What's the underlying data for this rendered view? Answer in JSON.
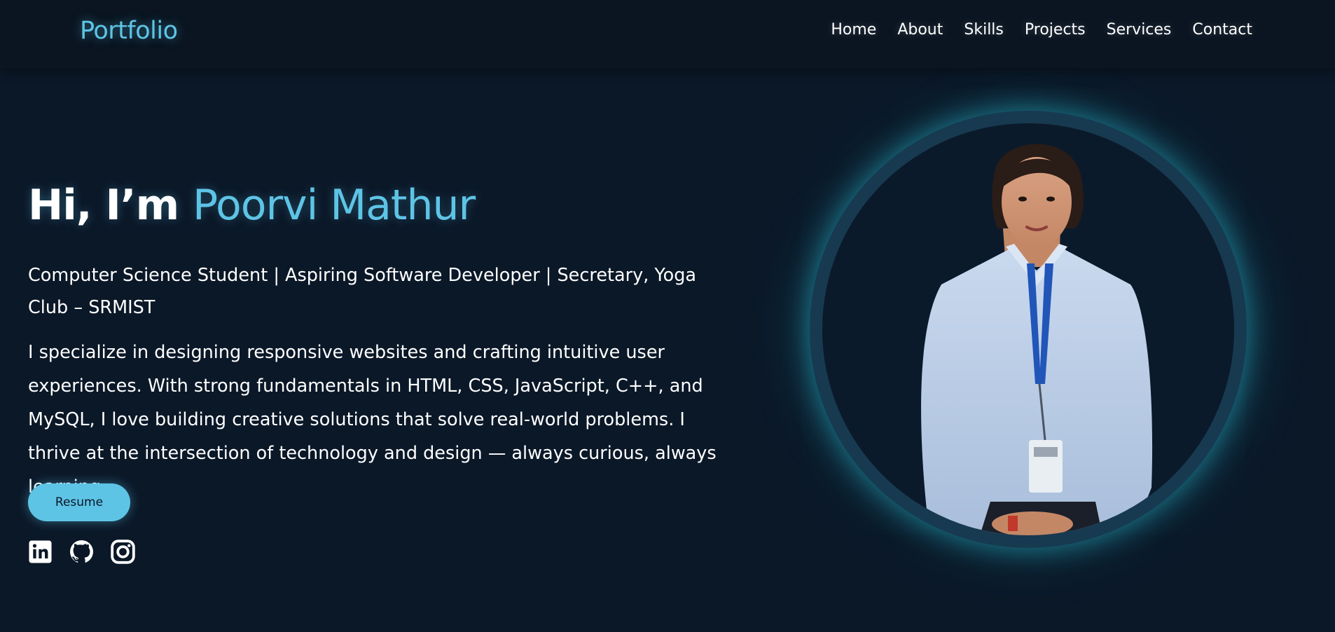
{
  "navbar": {
    "brand": "Portfolio",
    "links": [
      "Home",
      "About",
      "Skills",
      "Projects",
      "Services",
      "Contact"
    ]
  },
  "hero": {
    "greeting": "Hi, I’m",
    "name": "Poorvi Mathur",
    "subtitle": "Computer Science Student | Aspiring Software Developer | Secretary, Yoga Club – SRMIST",
    "bio": "I specialize in designing responsive websites and crafting intuitive user experiences. With strong fundamentals in HTML, CSS, JavaScript, C++, and MySQL, I love building creative solutions that solve real-world problems. I thrive at the intersection of technology and design — always curious, always learning.",
    "resume_label": "Resume"
  },
  "socials": [
    {
      "icon": "linkedin-icon"
    },
    {
      "icon": "github-icon"
    },
    {
      "icon": "instagram-icon"
    }
  ],
  "colors": {
    "accent": "#5ec4e6",
    "background": "#0b1727",
    "navbar": "#0a1521",
    "text": "#ffffff"
  }
}
